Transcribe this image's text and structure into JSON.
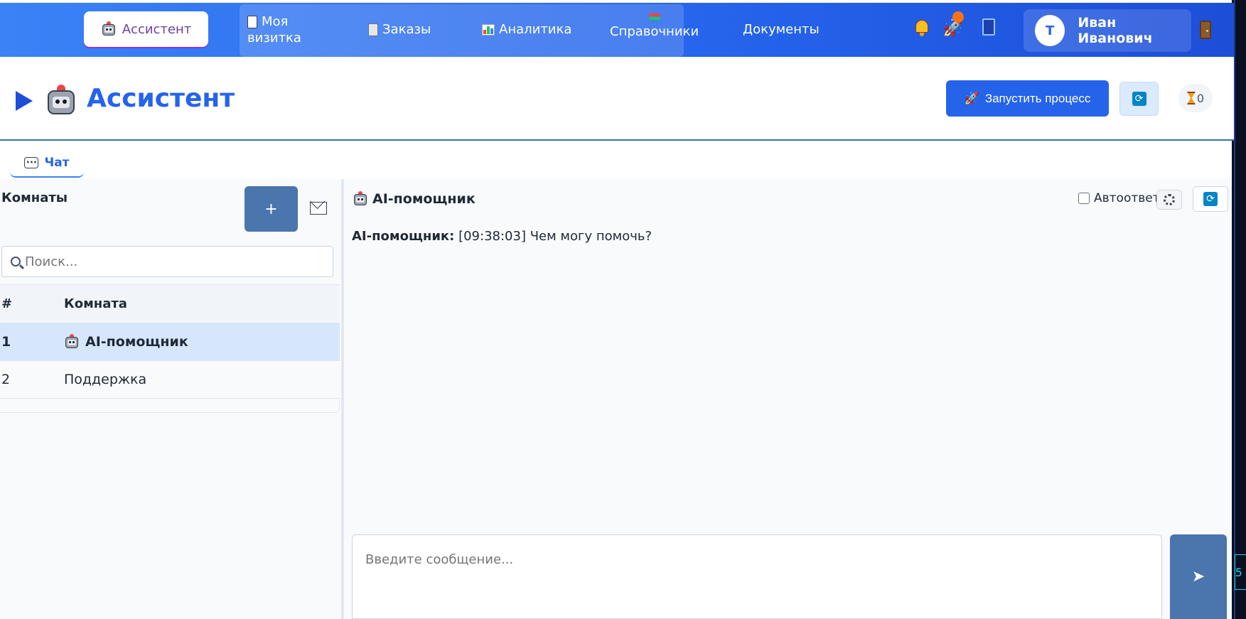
{
  "nav": {
    "items": [
      {
        "label": "Ассистент",
        "active": true,
        "icon": "robot-icon"
      },
      {
        "label_line1": "Моя",
        "label_line2": "визитка",
        "icon": "business-card-icon"
      },
      {
        "label": "Заказы",
        "icon": "clipboard-icon"
      },
      {
        "label": "Аналитика",
        "icon": "bar-chart-icon"
      },
      {
        "label": "Справочники",
        "icon": "books-icon"
      },
      {
        "label": "Документы"
      }
    ],
    "icons": [
      "bell-icon",
      "rocket-icon",
      "book-icon"
    ],
    "user": {
      "initial": "Т",
      "name": "Иван Иванович"
    },
    "logout_icon": "door-icon",
    "accent_color": "#2563eb"
  },
  "page": {
    "title": "Ассистент",
    "launch_button": "Запустить процесс",
    "pending_count": "0"
  },
  "tabs": [
    {
      "label": "Чат",
      "icon": "chat-icon"
    }
  ],
  "rooms": {
    "title": "Комнаты",
    "add_button": "+",
    "search_placeholder": "Поиск...",
    "columns": {
      "num": "#",
      "name": "Комната"
    },
    "rows": [
      {
        "num": "1",
        "name": "AI-помощник",
        "selected": true
      },
      {
        "num": "2",
        "name": "Поддержка",
        "selected": false
      }
    ]
  },
  "chat": {
    "title": "AI-помощник",
    "autoreply_label": "Автоответ",
    "autoreply_checked": false,
    "messages": [
      {
        "author": "AI-помощник:",
        "time": "[09:38:03]",
        "text": "Чем могу помочь?"
      }
    ],
    "input_placeholder": "Введите сообщение...",
    "send_icon": "➤"
  },
  "side_strip": {
    "text": "5"
  }
}
